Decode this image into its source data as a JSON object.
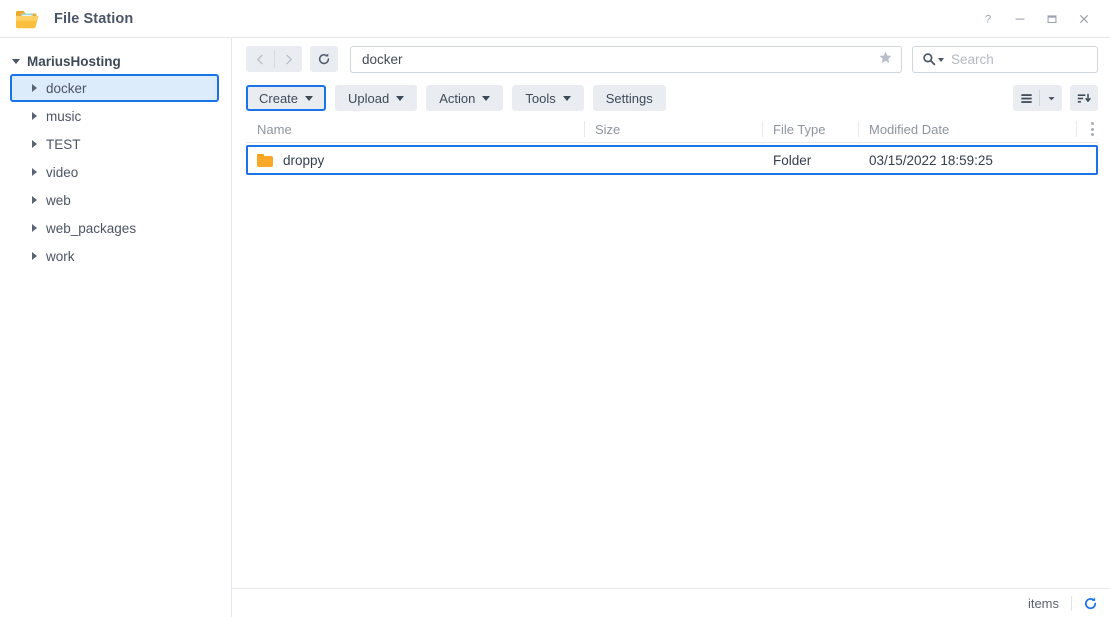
{
  "window": {
    "title": "File Station",
    "app_icon": "folder-open-icon",
    "controls": [
      {
        "name": "help-button",
        "label": "?"
      },
      {
        "name": "minimize-button",
        "label": "—"
      },
      {
        "name": "maximize-button",
        "label": "□"
      },
      {
        "name": "close-button",
        "label": "×"
      }
    ]
  },
  "sidebar": {
    "root": {
      "label": "MariusHosting",
      "expanded": true
    },
    "items": [
      {
        "label": "docker",
        "selected": true
      },
      {
        "label": "music",
        "selected": false
      },
      {
        "label": "TEST",
        "selected": false
      },
      {
        "label": "video",
        "selected": false
      },
      {
        "label": "web",
        "selected": false
      },
      {
        "label": "web_packages",
        "selected": false
      },
      {
        "label": "work",
        "selected": false
      }
    ]
  },
  "nav": {
    "back_icon": "chevron-left-icon",
    "forward_icon": "chevron-right-icon",
    "refresh_icon": "refresh-icon",
    "path_value": "docker",
    "path_placeholder": "",
    "favorite_icon": "star-icon",
    "search_icon": "search-icon",
    "search_placeholder": "Search",
    "search_value": ""
  },
  "toolbar": {
    "buttons": [
      {
        "label": "Create",
        "caret": true,
        "highlighted": true,
        "name": "create-button"
      },
      {
        "label": "Upload",
        "caret": true,
        "highlighted": false,
        "name": "upload-button"
      },
      {
        "label": "Action",
        "caret": true,
        "highlighted": false,
        "name": "action-button"
      },
      {
        "label": "Tools",
        "caret": true,
        "highlighted": false,
        "name": "tools-button"
      },
      {
        "label": "Settings",
        "caret": false,
        "highlighted": false,
        "name": "settings-button"
      }
    ],
    "view_icon": "list-view-icon",
    "view_caret_icon": "chevron-down-icon",
    "sort_icon": "sort-descending-icon"
  },
  "file_table": {
    "columns": [
      "Name",
      "Size",
      "File Type",
      "Modified Date"
    ],
    "options_icon": "more-options-icon",
    "rows": [
      {
        "icon": "folder-icon",
        "name": "droppy",
        "size": "",
        "type": "Folder",
        "modified": "03/15/2022 18:59:25",
        "selected": true
      }
    ]
  },
  "status": {
    "items_label": "items",
    "refresh_icon": "refresh-icon"
  },
  "colors": {
    "accent_blue": "#1a73e8",
    "selection_fill": "#ddecfb",
    "folder_orange": "#faa827",
    "button_gray": "#e9edf2",
    "text_dark": "#3f4a58",
    "text_muted": "#8d959f"
  }
}
